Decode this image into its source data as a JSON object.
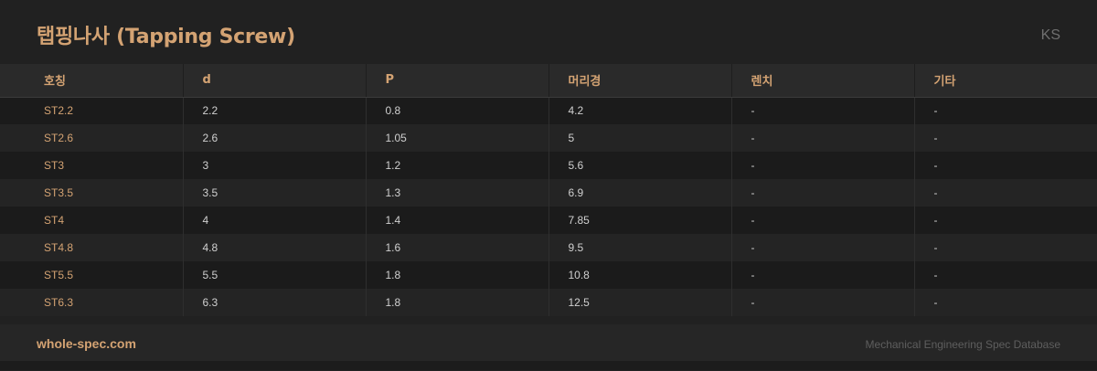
{
  "header": {
    "title": "탭핑나사 (Tapping Screw)",
    "standard": "KS"
  },
  "table": {
    "columns": [
      "호칭",
      "d",
      "P",
      "머리경",
      "렌치",
      "기타"
    ],
    "rows": [
      [
        "ST2.2",
        "2.2",
        "0.8",
        "4.2",
        "-",
        "-"
      ],
      [
        "ST2.6",
        "2.6",
        "1.05",
        "5",
        "-",
        "-"
      ],
      [
        "ST3",
        "3",
        "1.2",
        "5.6",
        "-",
        "-"
      ],
      [
        "ST3.5",
        "3.5",
        "1.3",
        "6.9",
        "-",
        "-"
      ],
      [
        "ST4",
        "4",
        "1.4",
        "7.85",
        "-",
        "-"
      ],
      [
        "ST4.8",
        "4.8",
        "1.6",
        "9.5",
        "-",
        "-"
      ],
      [
        "ST5.5",
        "5.5",
        "1.8",
        "10.8",
        "-",
        "-"
      ],
      [
        "ST6.3",
        "6.3",
        "1.8",
        "12.5",
        "-",
        "-"
      ]
    ]
  },
  "footer": {
    "site": "whole-spec.com",
    "tagline": "Mechanical Engineering Spec Database"
  },
  "colors": {
    "accent": "#d4a373",
    "background": "#212121"
  }
}
